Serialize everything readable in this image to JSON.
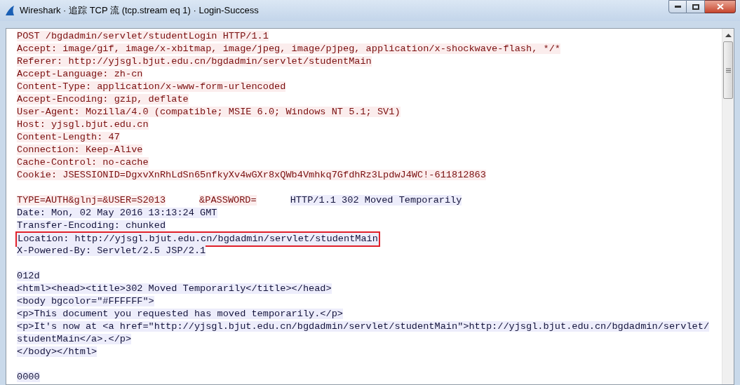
{
  "window": {
    "title": "Wireshark · 追踪 TCP 流 (tcp.stream eq 1) · Login-Success"
  },
  "stream": [
    {
      "kind": "client",
      "text": "POST /bgdadmin/servlet/studentLogin HTTP/1.1"
    },
    {
      "kind": "client",
      "text": "Accept: image/gif, image/x-xbitmap, image/jpeg, image/pjpeg, application/x-shockwave-flash, */*"
    },
    {
      "kind": "client",
      "text": "Referer: http://yjsgl.bjut.edu.cn/bgdadmin/servlet/studentMain"
    },
    {
      "kind": "client",
      "text": "Accept-Language: zh-cn"
    },
    {
      "kind": "client",
      "text": "Content-Type: application/x-www-form-urlencoded"
    },
    {
      "kind": "client",
      "text": "Accept-Encoding: gzip, deflate"
    },
    {
      "kind": "client",
      "text": "User-Agent: Mozilla/4.0 (compatible; MSIE 6.0; Windows NT 5.1; SV1)"
    },
    {
      "kind": "client",
      "text": "Host: yjsgl.bjut.edu.cn"
    },
    {
      "kind": "client",
      "text": "Content-Length: 47"
    },
    {
      "kind": "client",
      "text": "Connection: Keep-Alive"
    },
    {
      "kind": "client",
      "text": "Cache-Control: no-cache"
    },
    {
      "kind": "client",
      "text": "Cookie: JSESSIONID=DgxvXnRhLdSn65nfkyXv4wGXr8xQWb4Vmhkq7GfdhRz3LpdwJ4WC!-611812863"
    },
    {
      "kind": "blank"
    },
    {
      "kind": "mixed",
      "segments": [
        {
          "kind": "client",
          "text": "TYPE=AUTH&glnj=&USER=S2013"
        },
        {
          "kind": "redacted"
        },
        {
          "kind": "client",
          "text": "&PASSWORD="
        },
        {
          "kind": "redacted"
        },
        {
          "kind": "server",
          "text": "HTTP/1.1 302 Moved Temporarily"
        }
      ]
    },
    {
      "kind": "server",
      "text": "Date: Mon, 02 May 2016 13:13:24 GMT"
    },
    {
      "kind": "server",
      "text": "Transfer-Encoding: chunked"
    },
    {
      "kind": "server",
      "text": "Location: http://yjsgl.bjut.edu.cn/bgdadmin/servlet/studentMain",
      "highlighted": true
    },
    {
      "kind": "server",
      "text": "X-Powered-By: Servlet/2.5 JSP/2.1"
    },
    {
      "kind": "blank"
    },
    {
      "kind": "server",
      "text": "012d"
    },
    {
      "kind": "server",
      "text": "<html><head><title>302 Moved Temporarily</title></head>"
    },
    {
      "kind": "server",
      "text": "<body bgcolor=\"#FFFFFF\">"
    },
    {
      "kind": "server",
      "text": "<p>This document you requested has moved temporarily.</p>"
    },
    {
      "kind": "server",
      "text": "<p>It's now at <a href=\"http://yjsgl.bjut.edu.cn/bgdadmin/servlet/studentMain\">http://yjsgl.bjut.edu.cn/bgdadmin/servlet/"
    },
    {
      "kind": "server",
      "text": "studentMain</a>.</p>"
    },
    {
      "kind": "server",
      "text": "</body></html>"
    },
    {
      "kind": "blank"
    },
    {
      "kind": "server",
      "text": "0000"
    }
  ]
}
